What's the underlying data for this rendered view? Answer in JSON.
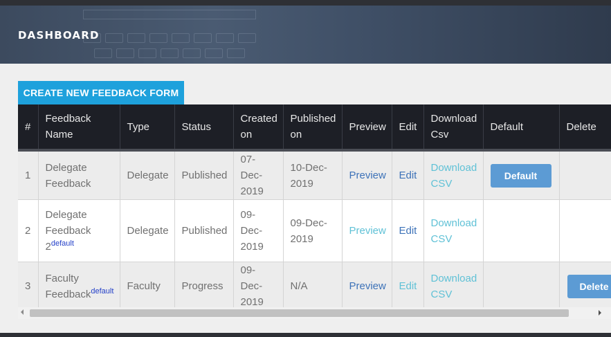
{
  "header": {
    "title": "DASHBOARD"
  },
  "actions": {
    "create_label": "CREATE NEW FEEDBACK FORM"
  },
  "table": {
    "columns": [
      "#",
      "Feedback Name",
      "Type",
      "Status",
      "Created on",
      "Published on",
      "Preview",
      "Edit",
      "Download Csv",
      "Default",
      "Delete"
    ],
    "rows": [
      {
        "num": "1",
        "name": "Delegate Feedback",
        "name_tag": "",
        "type": "Delegate",
        "status": "Published",
        "created": "07-Dec-2019",
        "published": "10-Dec-2019",
        "preview": "Preview",
        "edit": "Edit",
        "download": "Download CSV",
        "default_btn": "Default",
        "delete_btn": ""
      },
      {
        "num": "2",
        "name": "Delegate Feedback 2",
        "name_tag": "default",
        "type": "Delegate",
        "status": "Published",
        "created": "09-Dec-2019",
        "published": "09-Dec-2019",
        "preview": "Preview",
        "edit": "Edit",
        "download": "Download CSV",
        "default_btn": "",
        "delete_btn": ""
      },
      {
        "num": "3",
        "name": "Faculty Feedback",
        "name_tag": "default",
        "type": "Faculty",
        "status": "Progress",
        "created": "09-Dec-2019",
        "published": "N/A",
        "preview": "Preview",
        "edit": "Edit",
        "download": "Download CSV",
        "default_btn": "",
        "delete_btn": "Delete"
      }
    ]
  },
  "colors": {
    "header_bg": "#1d1f26",
    "primary": "#1ea1dc",
    "button": "#5c9bd4",
    "link_blue": "#3d72b8",
    "link_teal": "#5fc1d6"
  },
  "icons": {
    "scroll_left": "chevron-left-icon",
    "scroll_right": "chevron-right-icon"
  }
}
